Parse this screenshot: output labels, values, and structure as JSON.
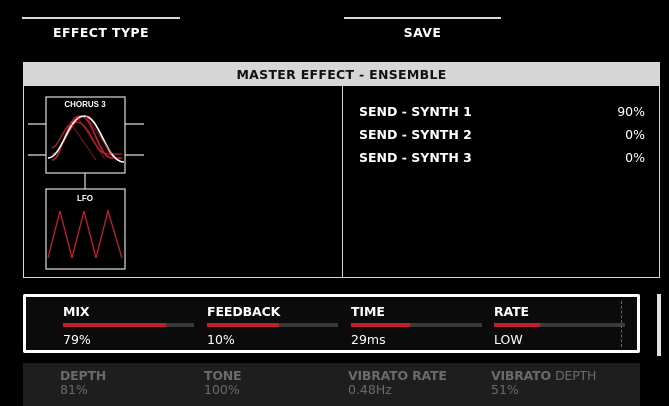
{
  "tabs": [
    {
      "label": "EFFECT TYPE"
    },
    {
      "label": "SAVE"
    }
  ],
  "panel": {
    "title": "MASTER EFFECT - ENSEMBLE",
    "diagram": {
      "chorus_label": "CHORUS 3",
      "lfo_label": "LFO"
    },
    "sends": [
      {
        "label": "SEND - SYNTH 1",
        "value": "90%"
      },
      {
        "label": "SEND - SYNTH 2",
        "value": "0%"
      },
      {
        "label": "SEND - SYNTH 3",
        "value": "0%"
      }
    ]
  },
  "params": [
    {
      "label": "MIX",
      "value": "79%",
      "level": 0.79
    },
    {
      "label": "FEEDBACK",
      "value": "10%",
      "level": 0.55
    },
    {
      "label": "TIME",
      "value": "29ms",
      "value_unit_small": true,
      "level": 0.45
    },
    {
      "label": "RATE",
      "value": "LOW",
      "level": 0.35
    }
  ],
  "params2": [
    {
      "label": "DEPTH",
      "value": "81%"
    },
    {
      "label": "TONE",
      "value": "100%"
    },
    {
      "label": "VIBRATO RATE",
      "value": "0.48Hz"
    },
    {
      "label_bold": "VIBRATO",
      "label_light": "DEPTH",
      "value": "51%"
    }
  ],
  "colors": {
    "accent": "#c41e2a",
    "panel_header": "#d6d6d6",
    "background": "#000000"
  }
}
